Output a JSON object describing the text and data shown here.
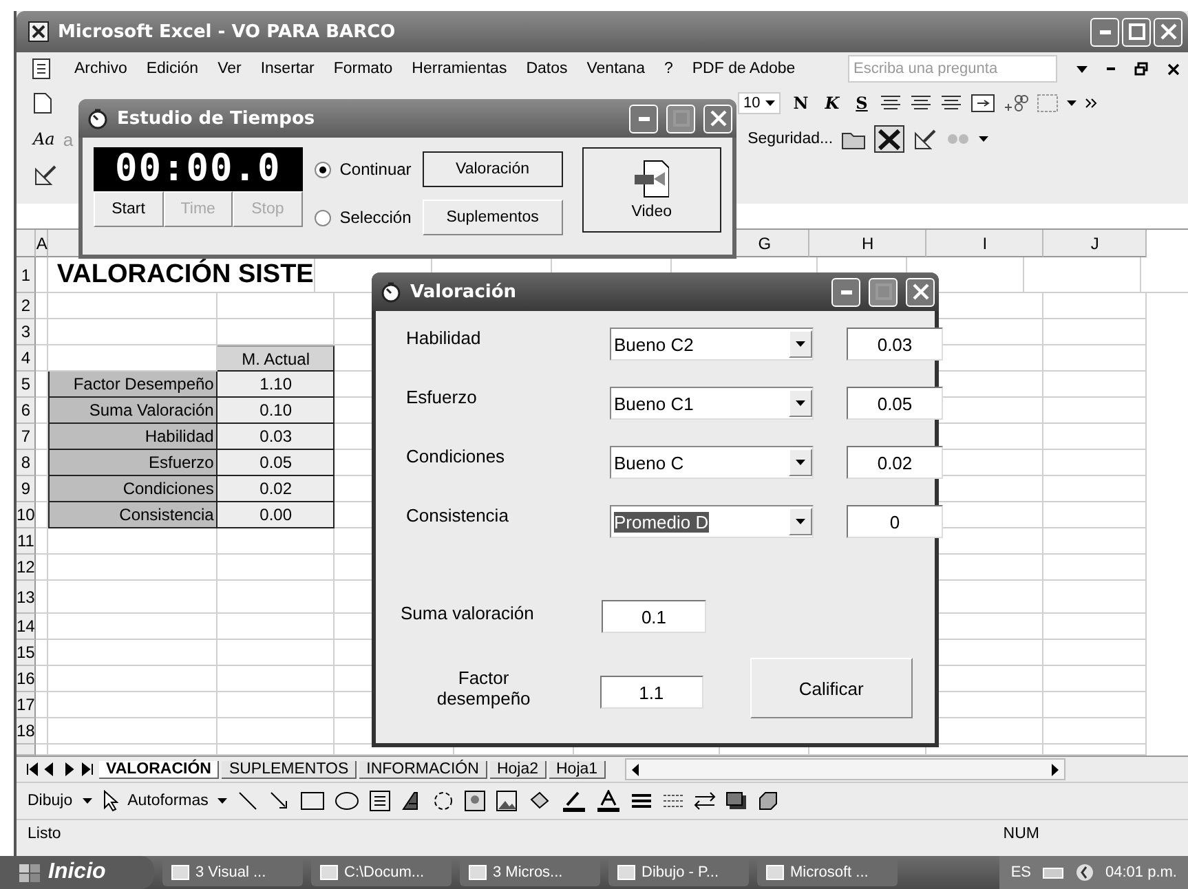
{
  "window": {
    "title": "Microsoft Excel - VO PARA BARCO"
  },
  "menu": [
    "Archivo",
    "Edición",
    "Ver",
    "Insertar",
    "Formato",
    "Herramientas",
    "Datos",
    "Ventana",
    "?",
    "PDF de Adobe"
  ],
  "help_box": {
    "placeholder": "Escriba una pregunta"
  },
  "toolbar": {
    "font_size": "10",
    "style_buttons": [
      "N",
      "K",
      "S"
    ],
    "styles_label": "Aa",
    "styles_sample": "a",
    "security": "Seguridad..."
  },
  "columns": [
    {
      "label": "A"
    },
    {
      "label": "G"
    },
    {
      "label": "H"
    },
    {
      "label": "I"
    },
    {
      "label": "J"
    }
  ],
  "rows": [
    {
      "number": "1",
      "kind": "title",
      "text": "VALORACIÓN SISTE"
    },
    {
      "number": "2",
      "kind": "empty"
    },
    {
      "number": "3",
      "kind": "empty"
    },
    {
      "number": "4",
      "kind": "header",
      "value": "M. Actual"
    },
    {
      "number": "5",
      "kind": "data",
      "label": "Factor Desempeño",
      "value": "1.10"
    },
    {
      "number": "6",
      "kind": "data",
      "label": "Suma Valoración",
      "value": "0.10"
    },
    {
      "number": "7",
      "kind": "data",
      "label": "Habilidad",
      "value": "0.03"
    },
    {
      "number": "8",
      "kind": "data",
      "label": "Esfuerzo",
      "value": "0.05"
    },
    {
      "number": "9",
      "kind": "data",
      "label": "Condiciones",
      "value": "0.02"
    },
    {
      "number": "10",
      "kind": "data",
      "label": "Consistencia",
      "value": "0.00"
    },
    {
      "number": "11",
      "kind": "empty"
    },
    {
      "number": "12",
      "kind": "empty"
    },
    {
      "number": "13",
      "kind": "empty"
    },
    {
      "number": "14",
      "kind": "empty"
    },
    {
      "number": "15",
      "kind": "empty"
    },
    {
      "number": "16",
      "kind": "empty"
    },
    {
      "number": "17",
      "kind": "empty"
    },
    {
      "number": "18",
      "kind": "empty"
    }
  ],
  "sheet_tabs": [
    {
      "label": "VALORACIÓN",
      "selected": true
    },
    {
      "label": "SUPLEMENTOS",
      "selected": false
    },
    {
      "label": "INFORMACIÓN",
      "selected": false
    },
    {
      "label": "Hoja2",
      "selected": false
    },
    {
      "label": "Hoja1",
      "selected": false
    }
  ],
  "drawing_toolbar": {
    "draw_menu": "Dibujo",
    "autoshapes": "Autoformas"
  },
  "status_bar": {
    "text": "Listo",
    "num": "NUM"
  },
  "estudio": {
    "title": "Estudio de Tiempos",
    "timer": "00:00.0",
    "timer_buttons": [
      {
        "label": "Start",
        "disabled": false
      },
      {
        "label": "Time",
        "disabled": true
      },
      {
        "label": "Stop",
        "disabled": true
      }
    ],
    "modes": [
      {
        "label": "Continuar",
        "selected": true
      },
      {
        "label": "Selección",
        "selected": false
      }
    ],
    "buttons": [
      "Valoración",
      "Suplementos"
    ],
    "video": "Video"
  },
  "valoracion": {
    "title": "Valoración",
    "factors": [
      {
        "label": "Habilidad",
        "choice": "Bueno C2",
        "value": "0.03",
        "highlighted": false
      },
      {
        "label": "Esfuerzo",
        "choice": "Bueno C1",
        "value": "0.05",
        "highlighted": false
      },
      {
        "label": "Condiciones",
        "choice": "Bueno C",
        "value": "0.02",
        "highlighted": false
      },
      {
        "label": "Consistencia",
        "choice": "Promedio D",
        "value": "0",
        "highlighted": true
      }
    ],
    "sum": {
      "label": "Suma valoración",
      "value": "0.1"
    },
    "factor": {
      "label": "Factor desempeño",
      "value": "1.1"
    },
    "button": "Calificar"
  },
  "taskbar": {
    "start": "Inicio",
    "items": [
      "3 Visual ...",
      "C:\\Docum...",
      "3 Micros...",
      "Dibujo - P...",
      "Microsoft ..."
    ],
    "language": "ES",
    "clock": "04:01 p.m."
  }
}
